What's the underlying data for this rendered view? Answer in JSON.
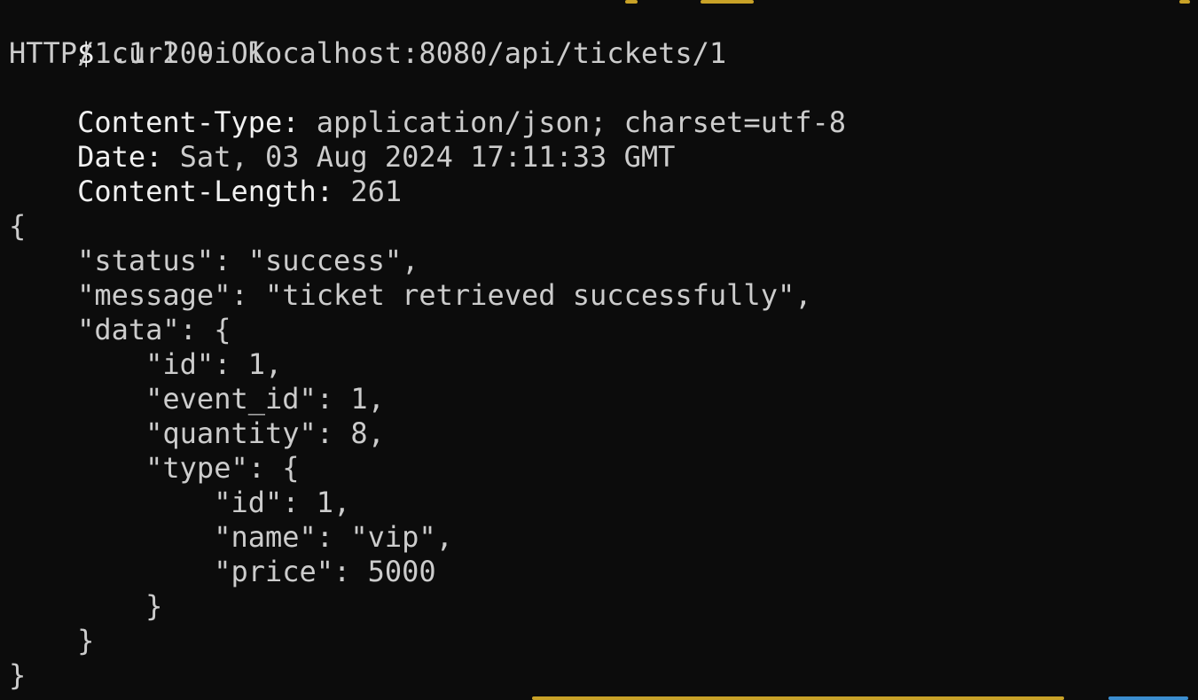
{
  "colors": {
    "background": "#0c0c0c",
    "header_key": "#f0f0f0",
    "text": "#cccccc",
    "artifact_yellow": "#c9a227",
    "artifact_blue": "#3b8ed0"
  },
  "terminal": {
    "command": {
      "prompt": "$",
      "text": "curl -i localhost:8080/api/tickets/1"
    },
    "status_line": "HTTP/1.1 200 OK",
    "headers": [
      {
        "key": "Content-Type:",
        "value": "application/json; charset=utf-8"
      },
      {
        "key": "Date:",
        "value": "Sat, 03 Aug 2024 17:11:33 GMT"
      },
      {
        "key": "Content-Length:",
        "value": "261"
      }
    ],
    "body_lines": [
      "{",
      "    \"status\": \"success\",",
      "    \"message\": \"ticket retrieved successfully\",",
      "    \"data\": {",
      "        \"id\": 1,",
      "        \"event_id\": 1,",
      "        \"quantity\": 8,",
      "        \"type\": {",
      "            \"id\": 1,",
      "            \"name\": \"vip\",",
      "            \"price\": 5000",
      "        }",
      "    }",
      "}"
    ]
  }
}
